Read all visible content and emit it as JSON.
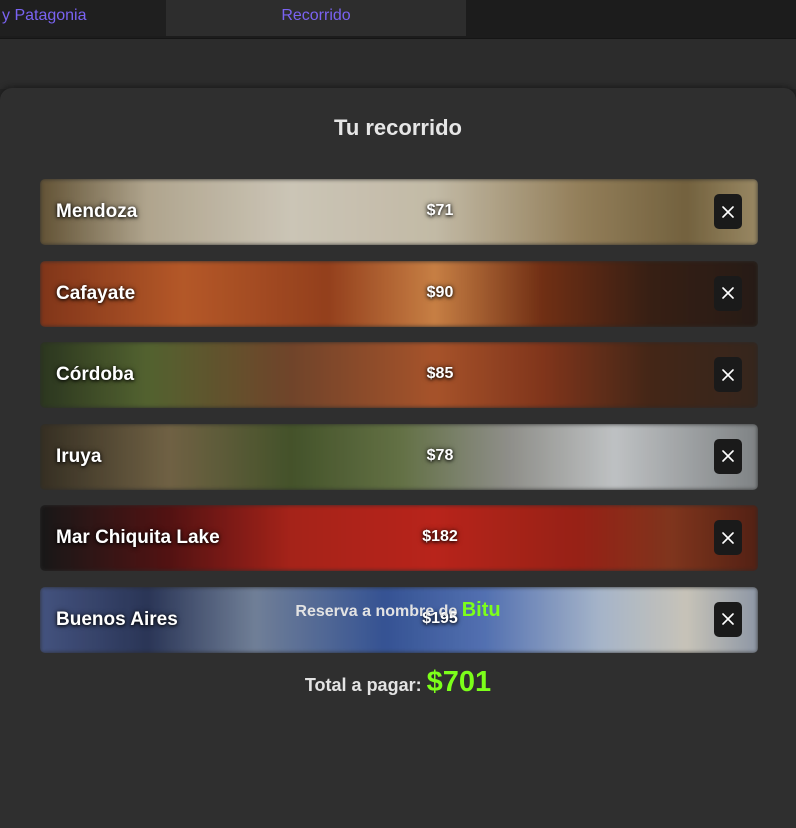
{
  "tabs": [
    {
      "label": "y Patagonia",
      "active": false
    },
    {
      "label": "Recorrido",
      "active": true
    }
  ],
  "panel": {
    "title": "Tu recorrido"
  },
  "trip_items": [
    {
      "name": "Mendoza",
      "price": "$71",
      "bg": "linear-gradient(90deg,#6b5a3a 0%,#bfb39a 15%,#ddd6c6 35%,#d3cab4 55%,#a08a62 75%,#7d6a44 90%,#a6946c 100%)"
    },
    {
      "name": "Cafayate",
      "price": "$90",
      "bg": "linear-gradient(90deg,#8c3a1c 0%,#c4602c 20%,#a0451f 40%,#d88a4a 55%,#7a3316 70%,#3c2216 85%,#2a1e18 100%)"
    },
    {
      "name": "Córdoba",
      "price": "$85",
      "bg": "linear-gradient(90deg,#2f3b22 0%,#5a6b34 15%,#7a4a2e 35%,#b55a2e 55%,#8c3a1e 70%,#4a2a1a 85%,#3a2a20 100%)"
    },
    {
      "name": "Iruya",
      "price": "$78",
      "bg": "linear-gradient(90deg,#3a3326 0%,#7a6a4a 18%,#4a5a2e 35%,#6b7a4a 50%,#9a9a94 65%,#cfd2d4 80%,#8a8e90 100%)"
    },
    {
      "name": "Mar Chiquita Lake",
      "price": "$182",
      "bg": "linear-gradient(90deg,#1a1a1a 0%,#5a1414 18%,#b4261c 35%,#c8281e 55%,#a42418 75%,#8a3a20 88%,#5a2416 100%)"
    },
    {
      "name": "Buenos Aires",
      "price": "$195",
      "bg": "linear-gradient(90deg,#4a5a8a 0%,#2e3a5e 15%,#7a8aa4 30%,#3a5aa0 48%,#5a7ac0 62%,#b4c4da 78%,#d8d4c8 90%,#9aa4b4 100%)"
    }
  ],
  "reserva": {
    "prefix": "Reserva a nombre de",
    "name": "Bitu"
  },
  "total": {
    "label": "Total a pagar:",
    "amount": "$701"
  },
  "colors": {
    "accent": "#7cff1a",
    "tab_text": "#7a63f2",
    "panel_bg": "#2f2f2f"
  }
}
